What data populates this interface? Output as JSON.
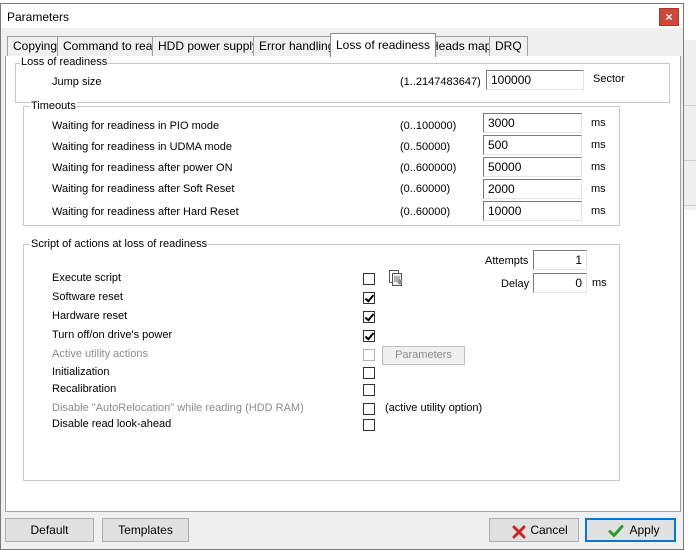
{
  "window": {
    "title": "Parameters",
    "close_label": "×"
  },
  "tabs": [
    {
      "label": "Copying"
    },
    {
      "label": "Command to read"
    },
    {
      "label": "HDD power supply"
    },
    {
      "label": "Error handling"
    },
    {
      "label": "Loss of readiness",
      "active": true
    },
    {
      "label": "Heads map"
    },
    {
      "label": "DRQ"
    }
  ],
  "loss_of_readiness": {
    "group_label": "Loss of readiness",
    "jump_size": {
      "label": "Jump size",
      "range": "(1..2147483647)",
      "value": "100000",
      "unit": "Sector"
    }
  },
  "timeouts": {
    "group_label": "Timeouts",
    "rows": [
      {
        "label": "Waiting for readiness in PIO mode",
        "range": "(0..100000)",
        "value": "3000",
        "unit": "ms"
      },
      {
        "label": "Waiting for readiness in UDMA mode",
        "range": "(0..50000)",
        "value": "500",
        "unit": "ms"
      },
      {
        "label": "Waiting for readiness after power ON",
        "range": "(0..600000)",
        "value": "50000",
        "unit": "ms"
      },
      {
        "label": "Waiting for readiness after Soft Reset",
        "range": "(0..60000)",
        "value": "2000",
        "unit": "ms"
      },
      {
        "label": "Waiting for readiness after Hard Reset",
        "range": "(0..60000)",
        "value": "10000",
        "unit": "ms"
      }
    ]
  },
  "script": {
    "group_label": "Script of actions at loss of readiness",
    "attempts": {
      "label": "Attempts",
      "value": "1"
    },
    "delay": {
      "label": "Delay",
      "value": "0",
      "unit": "ms"
    },
    "actions": [
      {
        "label": "Execute script",
        "checked": false,
        "disabled": false
      },
      {
        "label": "Software reset",
        "checked": true,
        "disabled": false
      },
      {
        "label": "Hardware reset",
        "checked": true,
        "disabled": false
      },
      {
        "label": "Turn off/on drive's power",
        "checked": true,
        "disabled": false
      },
      {
        "label": "Active utility actions",
        "checked": false,
        "disabled": true
      },
      {
        "label": "Initialization",
        "checked": false,
        "disabled": false
      },
      {
        "label": "Recalibration",
        "checked": false,
        "disabled": false
      },
      {
        "label": "Disable \"AutoRelocation\" while reading (HDD RAM)",
        "checked": false,
        "disabled": true
      },
      {
        "label": "Disable read look-ahead",
        "checked": false,
        "disabled": false
      }
    ],
    "parameters_button": "Parameters",
    "active_utility_option": "(active utility option)"
  },
  "footer": {
    "default_label": "Default",
    "templates_label": "Templates",
    "cancel_label": "Cancel",
    "apply_label": "Apply"
  },
  "colors": {
    "accent": "#0078d7",
    "cancel_icon": "#c62828",
    "apply_icon": "#2e9b2e"
  }
}
